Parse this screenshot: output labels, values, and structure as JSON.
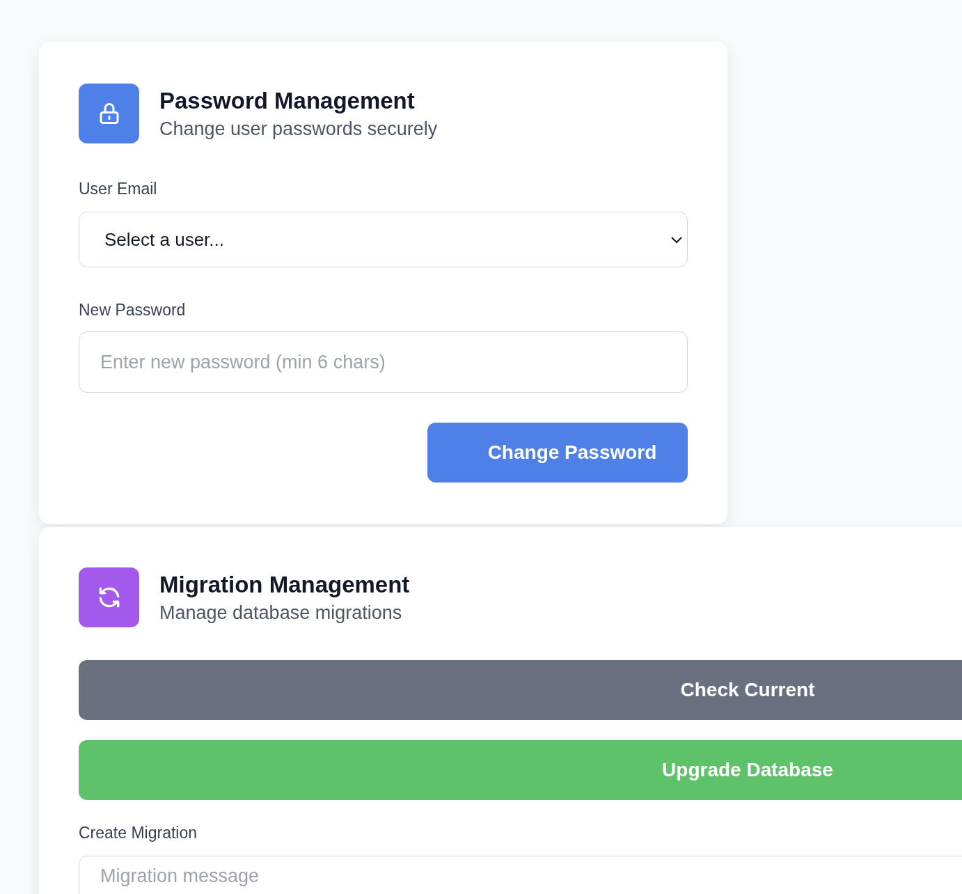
{
  "password_card": {
    "title": "Password Management",
    "subtitle": "Change user passwords securely",
    "user_email": {
      "label": "User Email",
      "value": "Select a user..."
    },
    "new_password": {
      "label": "New Password",
      "placeholder": "Enter new password (min 6 chars)"
    },
    "submit": "Change Password"
  },
  "migration_card": {
    "title": "Migration Management",
    "subtitle": "Manage database migrations",
    "actions": [
      {
        "label": "Check Current",
        "kind": "neutral"
      },
      {
        "label": "Upgrade Database",
        "kind": "success"
      }
    ],
    "create_migration": {
      "label": "Create Migration",
      "placeholder": "Migration message"
    }
  }
}
